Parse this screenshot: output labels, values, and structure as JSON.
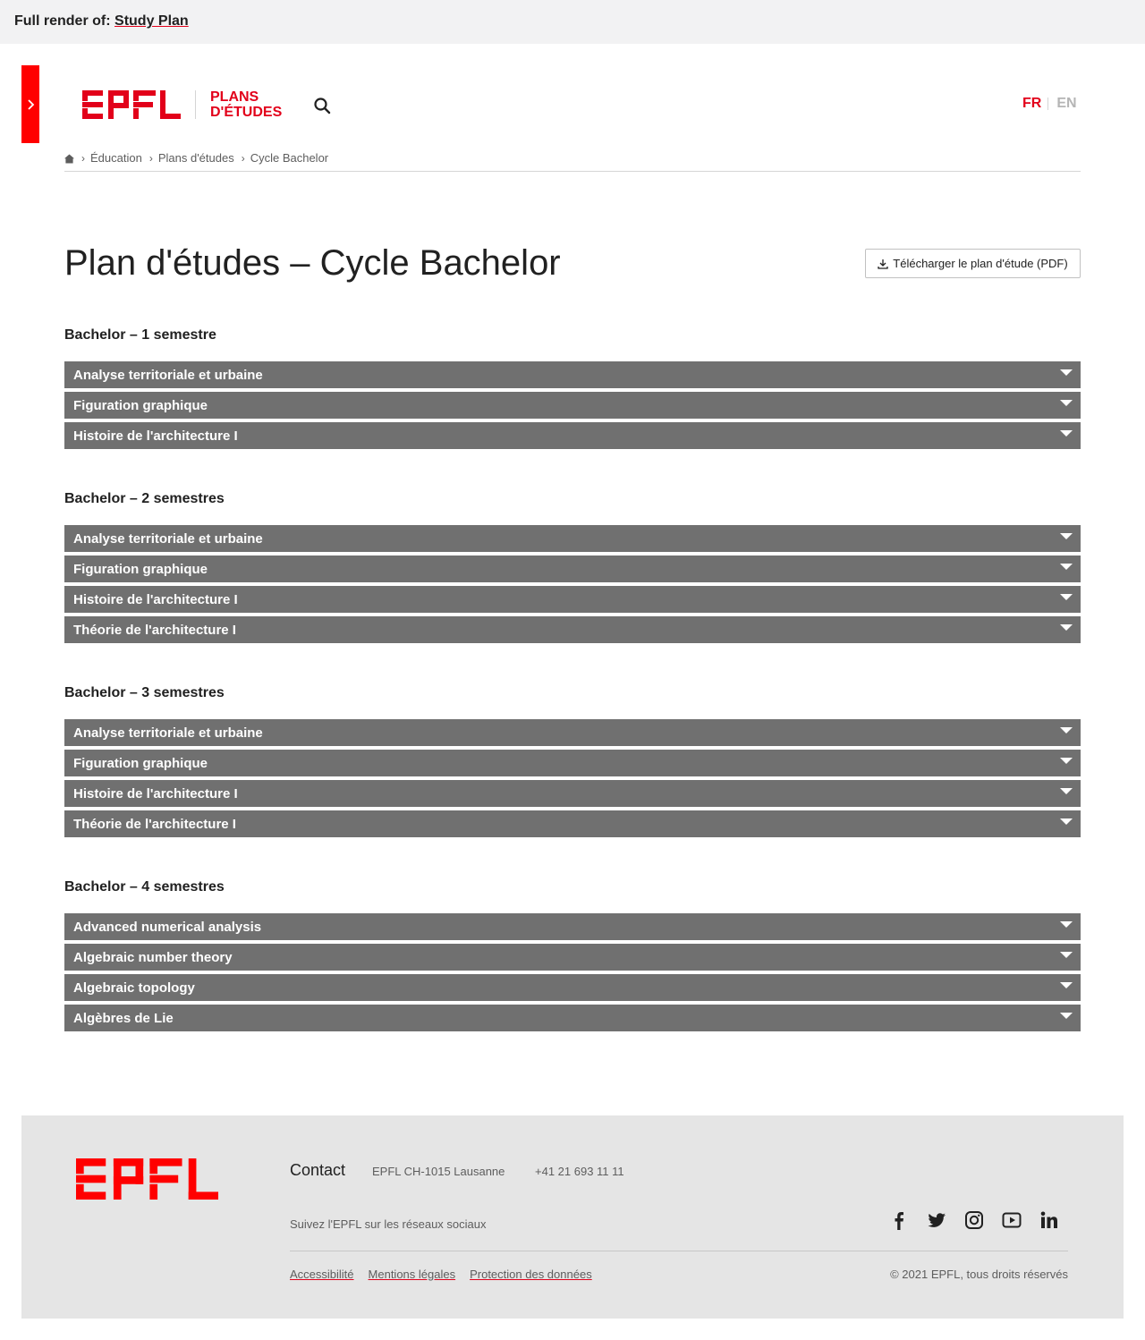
{
  "render_bar": {
    "prefix": "Full render of:",
    "link": "Study Plan"
  },
  "header": {
    "logo_text": "EPFL",
    "site_title_line1": "PLANS",
    "site_title_line2": "D'ÉTUDES",
    "lang_active": "FR",
    "lang_other": "EN"
  },
  "breadcrumb": {
    "items": [
      "Éducation",
      "Plans d'études",
      "Cycle Bachelor"
    ]
  },
  "page": {
    "title": "Plan d'études – Cycle Bachelor",
    "pdf_button": "Télécharger le plan d'étude (PDF)"
  },
  "semesters": [
    {
      "title": "Bachelor – 1 semestre",
      "courses": [
        "Analyse territoriale et urbaine",
        "Figuration graphique",
        "Histoire de l'architecture I"
      ]
    },
    {
      "title": "Bachelor – 2 semestres",
      "courses": [
        "Analyse territoriale et urbaine",
        "Figuration graphique",
        "Histoire de l'architecture I",
        "Théorie de l'architecture I"
      ]
    },
    {
      "title": "Bachelor – 3 semestres",
      "courses": [
        "Analyse territoriale et urbaine",
        "Figuration graphique",
        "Histoire de l'architecture I",
        "Théorie de l'architecture I"
      ]
    },
    {
      "title": "Bachelor – 4 semestres",
      "courses": [
        "Advanced numerical analysis",
        "Algebraic number theory",
        "Algebraic topology",
        "Algèbres de Lie"
      ]
    }
  ],
  "footer": {
    "contact_title": "Contact",
    "address": "EPFL CH-1015 Lausanne",
    "phone": "+41 21 693 11 11",
    "follow": "Suivez l'EPFL sur les réseaux sociaux",
    "social_icons": [
      "facebook-icon",
      "twitter-icon",
      "instagram-icon",
      "youtube-icon",
      "linkedin-icon"
    ],
    "links": [
      "Accessibilité",
      "Mentions légales",
      "Protection des données"
    ],
    "copyright": "© 2021 EPFL, tous droits réservés"
  },
  "colors": {
    "brand_red": "#e2001a",
    "accordion": "#707070",
    "footer_bg": "#e5e5e5"
  }
}
